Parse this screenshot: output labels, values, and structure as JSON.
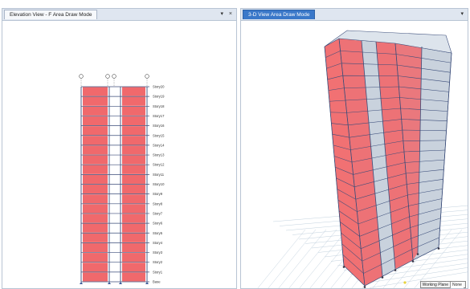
{
  "colors": {
    "panel_fill": "#f0696c",
    "panel_edge": "#c1272d",
    "frame": "#3b4d7a",
    "glass": "#c9d2dd",
    "ground_grid": "#b3c5d6"
  },
  "left_pane": {
    "tab_title": "Elevation View - F  Area Draw Mode",
    "pin_glyph": "▾",
    "close_glyph": "×",
    "story_labels": [
      "Story20",
      "Story19",
      "Story18",
      "Story17",
      "Story16",
      "Story15",
      "Story14",
      "Story13",
      "Story12",
      "Story11",
      "Story10",
      "Story9",
      "Story8",
      "Story7",
      "Story6",
      "Story5",
      "Story4",
      "Story3",
      "Story2",
      "Story1",
      "Base"
    ]
  },
  "right_pane": {
    "tab_title": "3-D View  Area Draw Mode",
    "pin_glyph": "▾",
    "status_label": "Working Plane",
    "status_value": "None"
  }
}
